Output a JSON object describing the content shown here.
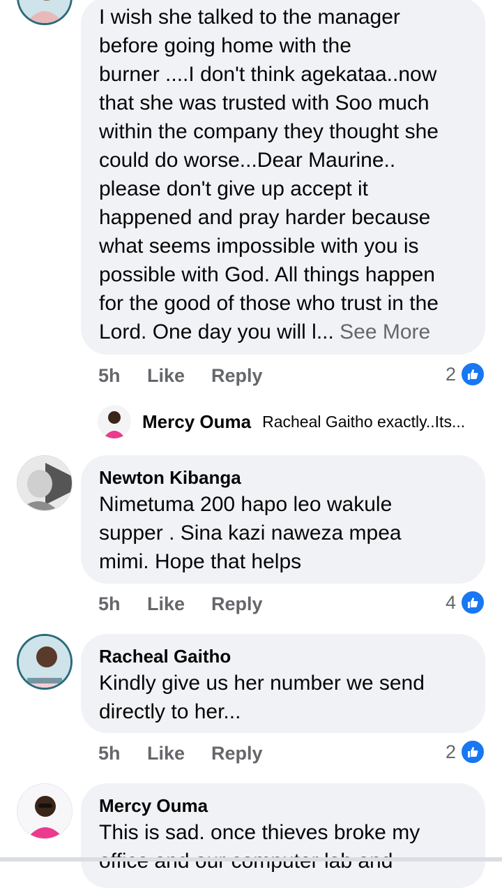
{
  "comments": [
    {
      "author": "",
      "text": "I wish she talked to the manager\nbefore going home with the\nburner ....I don't think agekataa..now\nthat she was trusted with Soo much\nwithin the company they thought she\ncould do worse...Dear Maurine..\nplease don't give up accept it\nhappened and pray harder because\nwhat seems impossible with you is\npossible with God. All things happen\nfor the good of those who trust in the\nLord. One day you will l... ",
      "see_more": "See More",
      "time": "5h",
      "like": "Like",
      "reply": "Reply",
      "reactions": "2"
    },
    {
      "author": "Newton Kibanga",
      "text": "Nimetuma 200 hapo leo wakule\nsupper . Sina kazi naweza mpea\nmimi. Hope that helps",
      "time": "5h",
      "like": "Like",
      "reply": "Reply",
      "reactions": "4"
    },
    {
      "author": "Racheal Gaitho",
      "text": "Kindly give us her number we send\ndirectly to her...",
      "time": "5h",
      "like": "Like",
      "reply": "Reply",
      "reactions": "2"
    },
    {
      "author": "Mercy Ouma",
      "text": "This is sad. once thieves broke my\noffice and our computer lab and"
    }
  ],
  "reply_preview": {
    "author": "Mercy Ouma",
    "text": "Racheal Gaitho exactly..Its..."
  },
  "icons": {
    "like_badge": "thumbs-up-icon",
    "accent": "#1877f2"
  }
}
